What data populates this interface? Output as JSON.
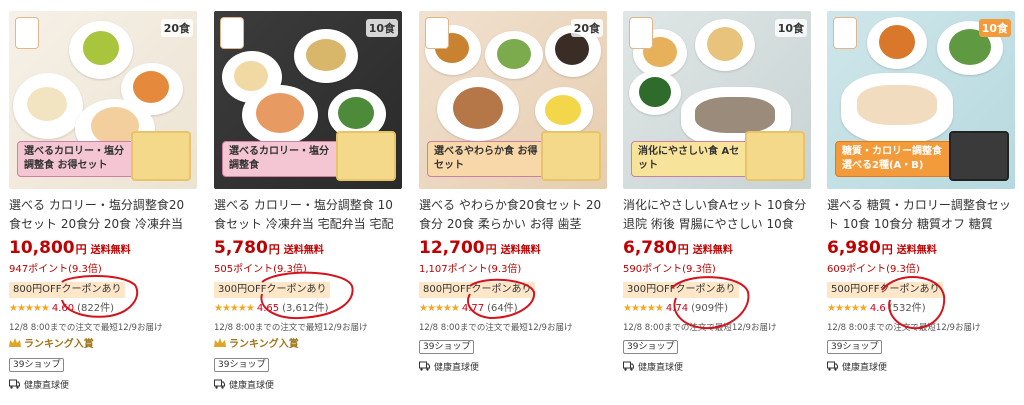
{
  "products": [
    {
      "count_tag": "20食",
      "banner": "選べるカロリー・塩分調整食 お得セット",
      "banner_color": "#f4c6d4",
      "title": "選べる カロリー・塩分調整食20食セット 20食分 20食 冷凍弁当 宅…",
      "price": "10,800",
      "yen": "円",
      "shipping": "送料無料",
      "points": "947ポイント(9.3倍)",
      "coupon": "800円OFFクーポンあり",
      "stars": "★★★★★",
      "score": "4.60",
      "reviews": "(822件)",
      "delivery": "12/8 8:00までの注文で最短12/9お届け",
      "ranking": "ランキング入賞",
      "shop": "39ショップ",
      "health": "健康直球便"
    },
    {
      "count_tag": "10食",
      "banner": "選べるカロリー・塩分調整食",
      "banner_color": "#f4c6d4",
      "title": "選べる カロリー・塩分調整食 10食セット 冷凍弁当 宅配弁当 宅配 …",
      "price": "5,780",
      "yen": "円",
      "shipping": "送料無料",
      "points": "505ポイント(9.3倍)",
      "coupon": "300円OFFクーポンあり",
      "stars": "★★★★★",
      "score": "4.65",
      "reviews": "(3,612件)",
      "delivery": "12/8 8:00までの注文で最短12/9お届け",
      "ranking": "ランキング入賞",
      "shop": "39ショップ",
      "health": "健康直球便"
    },
    {
      "count_tag": "20食",
      "banner": "選べるやわらか食 お得セット",
      "banner_color": "#f8d7a8",
      "title": "選べる やわらか食20食セット 20食分 20食 柔らかい お得 歯茎と…",
      "price": "12,700",
      "yen": "円",
      "shipping": "送料無料",
      "points": "1,107ポイント(9.3倍)",
      "coupon": "800円OFFクーポンあり",
      "stars": "★★★★★",
      "score": "4.77",
      "reviews": "(64件)",
      "delivery": "12/8 8:00までの注文で最短12/9お届け",
      "ranking": "",
      "shop": "39ショップ",
      "health": "健康直球便"
    },
    {
      "count_tag": "10食",
      "banner": "消化にやさしい食 Aセット",
      "banner_color": "#f7e39a",
      "title": "消化にやさしい食Aセット 10食分 退院 術後 胃腸にやさしい 10食 …",
      "price": "6,780",
      "yen": "円",
      "shipping": "送料無料",
      "points": "590ポイント(9.3倍)",
      "coupon": "300円OFFクーポンあり",
      "stars": "★★★★★",
      "score": "4.74",
      "reviews": "(909件)",
      "delivery": "12/8 8:00までの注文で最短12/9お届け",
      "ranking": "",
      "shop": "39ショップ",
      "health": "健康直球便"
    },
    {
      "count_tag": "10食",
      "banner": "糖質・カロリー調整食 選べる2種(A・B)",
      "banner_color": "#f39a3a",
      "title": "選べる 糖質・カロリー調整食セット 10食 10食分 糖質オフ 糖質カ…",
      "price": "6,980",
      "yen": "円",
      "shipping": "送料無料",
      "points": "609ポイント(9.3倍)",
      "coupon": "500円OFFクーポンあり",
      "stars": "★★★★★",
      "score": "4.6",
      "reviews": "(532件)",
      "delivery": "12/8 8:00までの注文で最短12/9お届け",
      "ranking": "",
      "shop": "39ショップ",
      "health": "健康直球便"
    }
  ],
  "colors": {
    "price_red": "#bf0000",
    "star_gold": "#f5a623",
    "annotation_red": "#d4141c",
    "coupon_bg": "#fde7c8"
  }
}
